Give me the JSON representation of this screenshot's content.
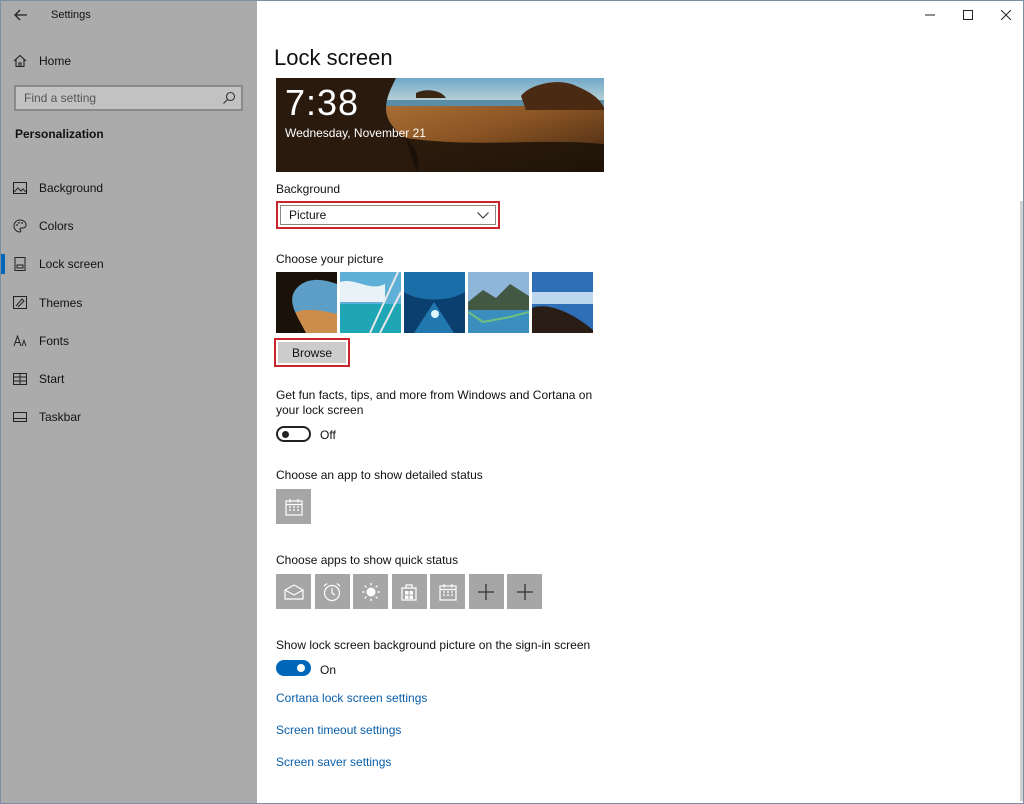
{
  "window": {
    "title": "Settings"
  },
  "sidebar": {
    "home_label": "Home",
    "search_placeholder": "Find a setting",
    "section_title": "Personalization",
    "items": [
      {
        "label": "Background",
        "icon": "picture-icon"
      },
      {
        "label": "Colors",
        "icon": "palette-icon"
      },
      {
        "label": "Lock screen",
        "icon": "lock-screen-icon",
        "active": true
      },
      {
        "label": "Themes",
        "icon": "themes-icon"
      },
      {
        "label": "Fonts",
        "icon": "fonts-icon"
      },
      {
        "label": "Start",
        "icon": "start-icon"
      },
      {
        "label": "Taskbar",
        "icon": "taskbar-icon"
      }
    ]
  },
  "main": {
    "page_title": "Lock screen",
    "preview": {
      "time": "7:38",
      "date": "Wednesday, November 21"
    },
    "background_label": "Background",
    "background_value": "Picture",
    "choose_picture_label": "Choose your picture",
    "browse_label": "Browse",
    "fun_facts_text": "Get fun facts, tips, and more from Windows and Cortana on your lock screen",
    "fun_facts_state": "Off",
    "detailed_status_label": "Choose an app to show detailed status",
    "quick_status_label": "Choose apps to show quick status",
    "quick_status_icons": [
      "mail-icon",
      "alarm-icon",
      "weather-icon",
      "store-icon",
      "calendar-icon",
      "plus-icon",
      "plus-icon"
    ],
    "signin_label": "Show lock screen background picture on the sign-in screen",
    "signin_state": "On",
    "links": [
      "Cortana lock screen settings",
      "Screen timeout settings",
      "Screen saver settings"
    ]
  },
  "colors": {
    "accent": "#0067b8",
    "highlight": "#c9262b",
    "sidebar_bg": "#ababab",
    "link": "#0a5ea8"
  }
}
